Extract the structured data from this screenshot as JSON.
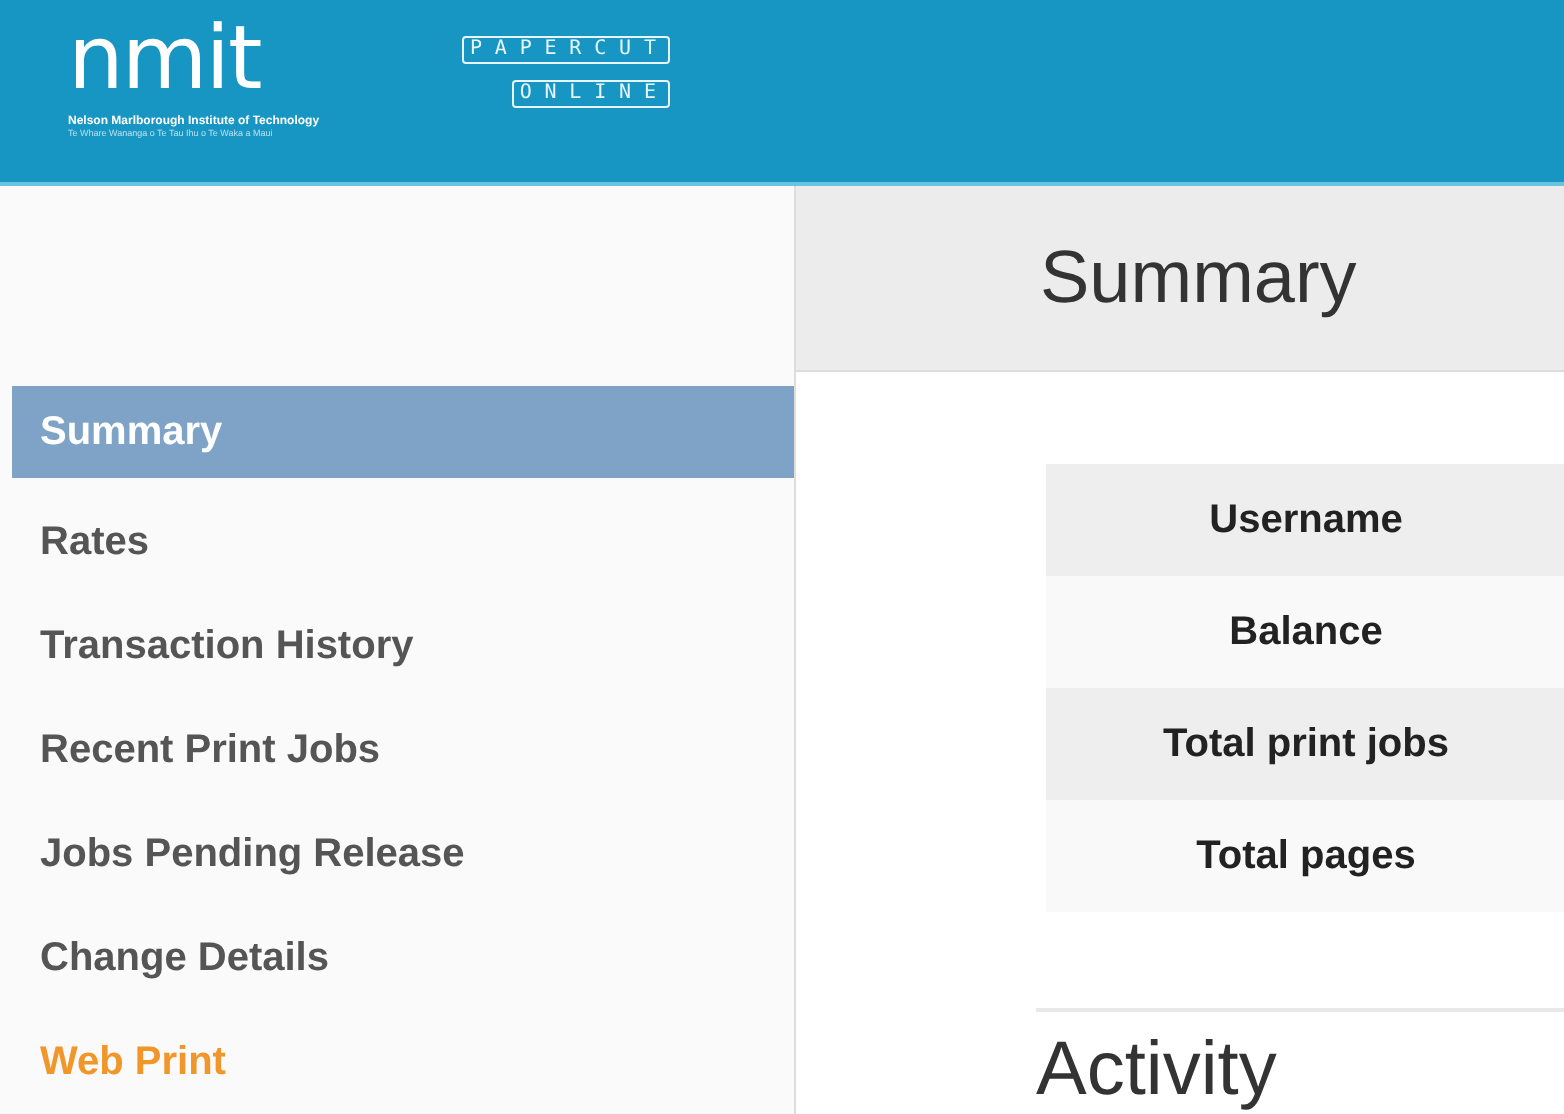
{
  "header": {
    "logo_text": "nmit",
    "logo_subtitle": "Nelson Marlborough Institute of Technology",
    "logo_tagline": "Te Whare Wananga o Te Tau Ihu o Te Waka a Maui",
    "brand_line_1": "PAPERCUT",
    "brand_line_2": "ONLINE"
  },
  "sidebar": {
    "items": [
      {
        "label": "Summary",
        "selected": true,
        "kind": "page"
      },
      {
        "label": "Rates",
        "selected": false,
        "kind": "page"
      },
      {
        "label": "Transaction History",
        "selected": false,
        "kind": "page"
      },
      {
        "label": "Recent Print Jobs",
        "selected": false,
        "kind": "page"
      },
      {
        "label": "Jobs Pending Release",
        "selected": false,
        "kind": "page"
      },
      {
        "label": "Change Details",
        "selected": false,
        "kind": "page"
      },
      {
        "label": "Web Print",
        "selected": false,
        "kind": "feature"
      }
    ]
  },
  "main": {
    "title": "Summary",
    "table": {
      "rows": [
        "Username",
        "Balance",
        "Total print jobs",
        "Total pages"
      ]
    },
    "section_title": "Activity"
  }
}
